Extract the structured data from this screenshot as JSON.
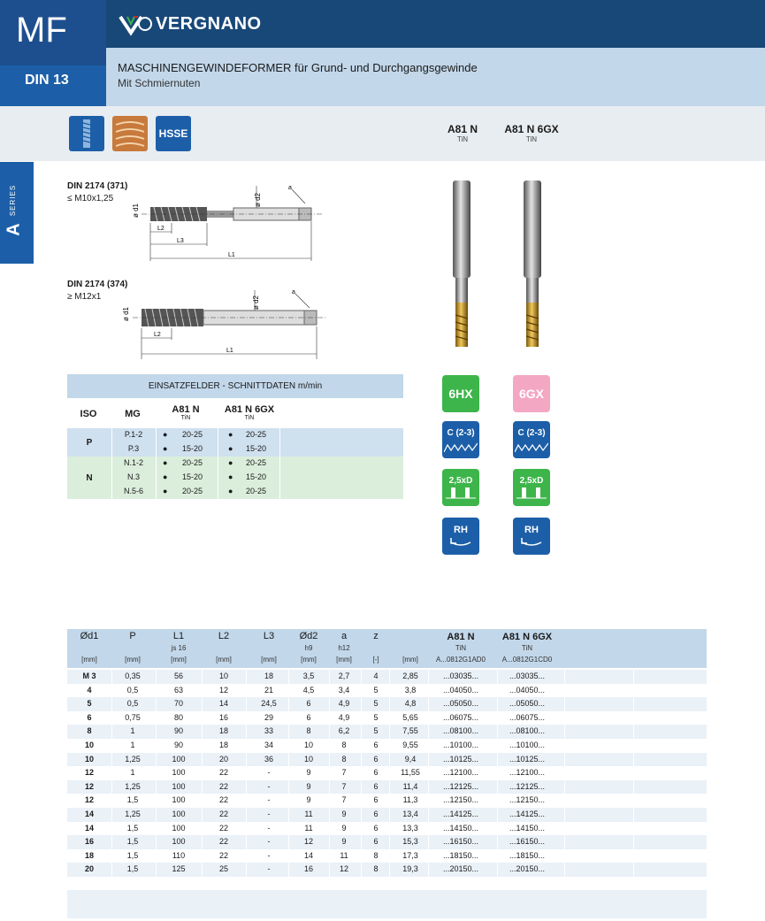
{
  "header": {
    "code": "MF",
    "standard": "DIN 13",
    "brand": "VERGNANO",
    "title": "MASCHINENGEWINDEFORMER für Grund- und Durchgangsgewinde",
    "subtitle": "Mit Schmiernuten",
    "material_badge": "HSSE"
  },
  "series": {
    "word": "SERIES",
    "letter": "A"
  },
  "products": [
    {
      "name": "A81 N",
      "coating": "TiN",
      "tolerance": "6HX",
      "tol_color": "#3db54a"
    },
    {
      "name": "A81 N 6GX",
      "coating": "TiN",
      "tolerance": "6GX",
      "tol_color": "#f4a7c3"
    }
  ],
  "icons": {
    "chamfer": "C (2-3)",
    "depth": "2,5xD",
    "hand": "RH"
  },
  "drawings": [
    {
      "standard": "DIN 2174 (371)",
      "range": "≤ M10x1,25",
      "d1": "ø d1",
      "d2": "ø d2",
      "l1": "L1",
      "l2": "L2",
      "l3": "L3",
      "a": "a"
    },
    {
      "standard": "DIN 2174 (374)",
      "range": "≥ M12x1",
      "d1": "ø d1",
      "d2": "ø d2",
      "l1": "L1",
      "l2": "L2",
      "a": "a"
    }
  ],
  "cutting": {
    "title": "EINSATZFELDER - SCHNITTDATEN m/min",
    "headers": {
      "iso": "ISO",
      "mg": "MG",
      "p1": "A81 N",
      "p1c": "TiN",
      "p2": "A81 N 6GX",
      "p2c": "TiN"
    },
    "groups": [
      {
        "iso": "P",
        "rows": [
          {
            "mg": "P.1-2",
            "v1": "20-25",
            "v2": "20-25"
          },
          {
            "mg": "P.3",
            "v1": "15-20",
            "v2": "15-20"
          }
        ]
      },
      {
        "iso": "N",
        "rows": [
          {
            "mg": "N.1-2",
            "v1": "20-25",
            "v2": "20-25"
          },
          {
            "mg": "N.3",
            "v1": "15-20",
            "v2": "15-20"
          },
          {
            "mg": "N.5-6",
            "v1": "20-25",
            "v2": "20-25"
          }
        ]
      }
    ]
  },
  "table": {
    "headers": [
      "Ød1",
      "P",
      "L1",
      "L2",
      "L3",
      "Ød2",
      "a",
      "z",
      "",
      "A81 N",
      "A81 N 6GX"
    ],
    "sub": [
      "",
      "",
      "js 16",
      "",
      "",
      "h9",
      "h12",
      "",
      "",
      "TiN",
      "TiN"
    ],
    "units": [
      "[mm]",
      "[mm]",
      "[mm]",
      "[mm]",
      "[mm]",
      "[mm]",
      "[mm]",
      "[-]",
      "[mm]",
      "A...0812G1AD0",
      "A...0812G1CD0"
    ],
    "rows": [
      [
        "M 3",
        "0,35",
        "56",
        "10",
        "18",
        "3,5",
        "2,7",
        "4",
        "2,85",
        "...03035...",
        "...03035..."
      ],
      [
        "4",
        "0,5",
        "63",
        "12",
        "21",
        "4,5",
        "3,4",
        "5",
        "3,8",
        "...04050...",
        "...04050..."
      ],
      [
        "5",
        "0,5",
        "70",
        "14",
        "24,5",
        "6",
        "4,9",
        "5",
        "4,8",
        "...05050...",
        "...05050..."
      ],
      [
        "6",
        "0,75",
        "80",
        "16",
        "29",
        "6",
        "4,9",
        "5",
        "5,65",
        "...06075...",
        "...06075..."
      ],
      [
        "8",
        "1",
        "90",
        "18",
        "33",
        "8",
        "6,2",
        "5",
        "7,55",
        "...08100...",
        "...08100..."
      ],
      [
        "10",
        "1",
        "90",
        "18",
        "34",
        "10",
        "8",
        "6",
        "9,55",
        "...10100...",
        "...10100..."
      ],
      [
        "10",
        "1,25",
        "100",
        "20",
        "36",
        "10",
        "8",
        "6",
        "9,4",
        "...10125...",
        "...10125..."
      ],
      [
        "12",
        "1",
        "100",
        "22",
        "-",
        "9",
        "7",
        "6",
        "11,55",
        "...12100...",
        "...12100..."
      ],
      [
        "12",
        "1,25",
        "100",
        "22",
        "-",
        "9",
        "7",
        "6",
        "11,4",
        "...12125...",
        "...12125..."
      ],
      [
        "12",
        "1,5",
        "100",
        "22",
        "-",
        "9",
        "7",
        "6",
        "11,3",
        "...12150...",
        "...12150..."
      ],
      [
        "14",
        "1,25",
        "100",
        "22",
        "-",
        "11",
        "9",
        "6",
        "13,4",
        "...14125...",
        "...14125..."
      ],
      [
        "14",
        "1,5",
        "100",
        "22",
        "-",
        "11",
        "9",
        "6",
        "13,3",
        "...14150...",
        "...14150..."
      ],
      [
        "16",
        "1,5",
        "100",
        "22",
        "-",
        "12",
        "9",
        "6",
        "15,3",
        "...16150...",
        "...16150..."
      ],
      [
        "18",
        "1,5",
        "110",
        "22",
        "-",
        "14",
        "11",
        "8",
        "17,3",
        "...18150...",
        "...18150..."
      ],
      [
        "20",
        "1,5",
        "125",
        "25",
        "-",
        "16",
        "12",
        "8",
        "19,3",
        "...20150...",
        "...20150..."
      ]
    ]
  }
}
